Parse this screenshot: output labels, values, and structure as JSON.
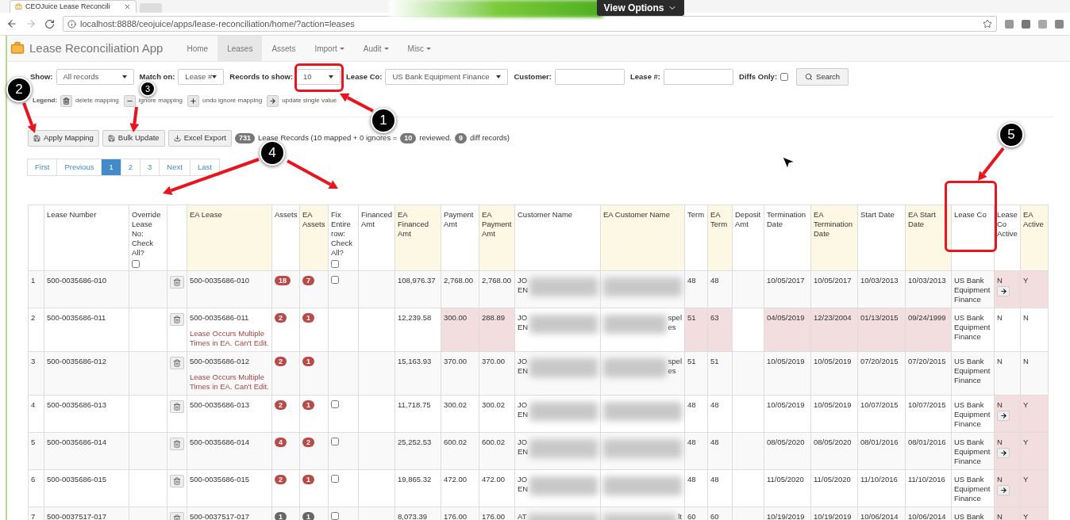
{
  "browser": {
    "tab_title": "CEOJuice Lease Reconcili",
    "view_options": "View Options",
    "url": "localhost:8888/ceojuice/apps/lease-reconciliation/home/?action=leases"
  },
  "app": {
    "title": "Lease Reconciliation App",
    "nav": [
      {
        "label": "Home",
        "selected": false,
        "dropdown": false
      },
      {
        "label": "Leases",
        "selected": true,
        "dropdown": false
      },
      {
        "label": "Assets",
        "selected": false,
        "dropdown": false
      },
      {
        "label": "Import",
        "selected": false,
        "dropdown": true
      },
      {
        "label": "Audit",
        "selected": false,
        "dropdown": true
      },
      {
        "label": "Misc",
        "selected": false,
        "dropdown": true
      }
    ]
  },
  "filters": [
    {
      "kind": "select",
      "label": "Show:",
      "value": "All records"
    },
    {
      "kind": "select",
      "label": "Match on:",
      "value": "Lease #"
    },
    {
      "kind": "select",
      "label": "Records to show:",
      "value": "10"
    },
    {
      "kind": "select",
      "label": "Lease Co:",
      "value": "US Bank Equipment Finance"
    },
    {
      "kind": "input",
      "label": "Customer:"
    },
    {
      "kind": "input",
      "label": "Lease #:"
    },
    {
      "kind": "checkbox",
      "label": "Diffs Only:",
      "checked": false
    }
  ],
  "search_button": "Search",
  "legend": {
    "label": "Legend:",
    "items": [
      {
        "text": "delete mapping"
      },
      {
        "text": "ignore mapping"
      },
      {
        "text": "undo ignore mapping"
      },
      {
        "text": "update single value"
      }
    ]
  },
  "actions": [
    {
      "label": "Apply Mapping"
    },
    {
      "label": "Bulk Update"
    },
    {
      "label": "Excel Export"
    }
  ],
  "summary": [
    {
      "kind": "badge",
      "text": "731"
    },
    {
      "kind": "text",
      "text": "Lease Records (10 mapped + 0 ignores ="
    },
    {
      "kind": "badge",
      "text": "10"
    },
    {
      "kind": "text",
      "text": "reviewed."
    },
    {
      "kind": "badge",
      "text": "9"
    },
    {
      "kind": "text",
      "text": "diff records)"
    }
  ],
  "pagination": [
    {
      "label": "First",
      "selected": false
    },
    {
      "label": "Previous",
      "selected": false
    },
    {
      "label": "1",
      "selected": true
    },
    {
      "label": "2",
      "selected": false
    },
    {
      "label": "3",
      "selected": false
    },
    {
      "label": "Next",
      "selected": false
    },
    {
      "label": "Last",
      "selected": false
    }
  ],
  "table": {
    "columns": [
      {
        "ea": false
      },
      {
        "label": "Lease Number",
        "ea": false
      },
      {
        "label": "Override Lease No: Check All?",
        "ea": false,
        "check_all": false
      },
      {
        "ea": false
      },
      {
        "label": "EA Lease",
        "ea": true
      },
      {
        "label": "Assets",
        "ea": false
      },
      {
        "label": "EA Assets",
        "ea": true
      },
      {
        "label": "Fix Entire row: Check All?",
        "ea": false,
        "check_all": false
      },
      {
        "label": "Financed Amt",
        "ea": false
      },
      {
        "label": "EA Financed Amt",
        "ea": true
      },
      {
        "label": "Payment Amt",
        "ea": false
      },
      {
        "label": "EA Payment Amt",
        "ea": true
      },
      {
        "label": "Customer Name",
        "ea": false
      },
      {
        "label": "EA Customer Name",
        "ea": true
      },
      {
        "label": "Term",
        "ea": false
      },
      {
        "label": "EA Term",
        "ea": true
      },
      {
        "label": "Deposit Amt",
        "ea": false
      },
      {
        "label": "Termination Date",
        "ea": false
      },
      {
        "label": "EA Termination Date",
        "ea": true
      },
      {
        "label": "Start Date",
        "ea": false
      },
      {
        "label": "EA Start Date",
        "ea": true
      },
      {
        "label": "Lease Co",
        "ea": false
      },
      {
        "label": "Lease Co Active",
        "ea": false
      },
      {
        "label": "EA Active",
        "ea": true
      }
    ],
    "rows": [
      {
        "cells": [
          {
            "kind": "text",
            "text": "1",
            "diff": false
          },
          {
            "kind": "text",
            "text": "500-0035686-010",
            "diff": false
          },
          {
            "kind": "empty",
            "diff": false
          },
          {
            "kind": "trash",
            "diff": false
          },
          {
            "kind": "lease",
            "text": "500-0035686-010",
            "diff": false
          },
          {
            "kind": "badge",
            "text": "18",
            "color": "#b94a48",
            "diff": false
          },
          {
            "kind": "badge",
            "text": "7",
            "color": "#b94a48",
            "diff": false
          },
          {
            "kind": "checkbox",
            "checked": false,
            "diff": false
          },
          {
            "kind": "empty",
            "diff": false
          },
          {
            "kind": "text",
            "text": "108,976.37",
            "diff": false
          },
          {
            "kind": "text",
            "text": "2,768.00",
            "diff": false
          },
          {
            "kind": "text",
            "text": "2,768.00",
            "diff": false
          },
          {
            "kind": "blurred",
            "lines": [
              "JO",
              "EN"
            ],
            "diff": false
          },
          {
            "kind": "blurred",
            "diff": false
          },
          {
            "kind": "text",
            "text": "48",
            "diff": false
          },
          {
            "kind": "text",
            "text": "48",
            "diff": false
          },
          {
            "kind": "empty",
            "diff": false
          },
          {
            "kind": "text",
            "text": "10/05/2017",
            "diff": false
          },
          {
            "kind": "text",
            "text": "10/05/2017",
            "diff": false
          },
          {
            "kind": "text",
            "text": "10/03/2013",
            "diff": false
          },
          {
            "kind": "text",
            "text": "10/03/2013",
            "diff": false
          },
          {
            "kind": "text",
            "text": "US Bank Equipment Finance",
            "diff": false
          },
          {
            "kind": "active",
            "text": "N",
            "update_button": true,
            "diff": true
          },
          {
            "kind": "text",
            "text": "Y",
            "diff": true
          }
        ]
      },
      {
        "cells": [
          {
            "kind": "text",
            "text": "2",
            "diff": false
          },
          {
            "kind": "text",
            "text": "500-0035686-011",
            "diff": false
          },
          {
            "kind": "empty",
            "diff": false
          },
          {
            "kind": "trash",
            "diff": false
          },
          {
            "kind": "lease",
            "text": "500-0035686-011",
            "warning": "Lease Occurs Multiple Times in EA. Can't Edit.",
            "diff": false
          },
          {
            "kind": "badge",
            "text": "2",
            "color": "#b94a48",
            "diff": false
          },
          {
            "kind": "badge",
            "text": "1",
            "color": "#b94a48",
            "diff": false
          },
          {
            "kind": "empty",
            "diff": false
          },
          {
            "kind": "empty",
            "diff": false
          },
          {
            "kind": "text",
            "text": "12,239.58",
            "diff": false
          },
          {
            "kind": "text",
            "text": "300.00",
            "diff": true
          },
          {
            "kind": "text",
            "text": "288.89",
            "diff": true
          },
          {
            "kind": "blurred",
            "lines": [
              "JO",
              "EN"
            ],
            "diff": false
          },
          {
            "kind": "blurred",
            "lines": [
              "spel",
              "es"
            ],
            "diff": false
          },
          {
            "kind": "text",
            "text": "51",
            "diff": true
          },
          {
            "kind": "text",
            "text": "63",
            "diff": true
          },
          {
            "kind": "empty",
            "diff": false
          },
          {
            "kind": "text",
            "text": "04/05/2019",
            "diff": true
          },
          {
            "kind": "text",
            "text": "12/23/2004",
            "diff": true
          },
          {
            "kind": "text",
            "text": "01/13/2015",
            "diff": true
          },
          {
            "kind": "text",
            "text": "09/24/1999",
            "diff": true
          },
          {
            "kind": "text",
            "text": "US Bank Equipment Finance",
            "diff": false
          },
          {
            "kind": "active",
            "text": "N",
            "update_button": false,
            "diff": false
          },
          {
            "kind": "text",
            "text": "N",
            "diff": false
          }
        ]
      },
      {
        "cells": [
          {
            "kind": "text",
            "text": "3",
            "diff": false
          },
          {
            "kind": "text",
            "text": "500-0035686-012",
            "diff": false
          },
          {
            "kind": "empty",
            "diff": false
          },
          {
            "kind": "trash",
            "diff": false
          },
          {
            "kind": "lease",
            "text": "500-0035686-012",
            "warning": "Lease Occurs Multiple Times in EA. Can't Edit.",
            "diff": false
          },
          {
            "kind": "badge",
            "text": "2",
            "color": "#b94a48",
            "diff": false
          },
          {
            "kind": "badge",
            "text": "1",
            "color": "#b94a48",
            "diff": false
          },
          {
            "kind": "empty",
            "diff": false
          },
          {
            "kind": "empty",
            "diff": false
          },
          {
            "kind": "text",
            "text": "15,163.93",
            "diff": false
          },
          {
            "kind": "text",
            "text": "370.00",
            "diff": false
          },
          {
            "kind": "text",
            "text": "370.00",
            "diff": false
          },
          {
            "kind": "blurred",
            "lines": [
              "JO",
              "EN"
            ],
            "diff": false
          },
          {
            "kind": "blurred",
            "lines": [
              "spel",
              "es"
            ],
            "diff": false
          },
          {
            "kind": "text",
            "text": "51",
            "diff": false
          },
          {
            "kind": "text",
            "text": "51",
            "diff": false
          },
          {
            "kind": "empty",
            "diff": false
          },
          {
            "kind": "text",
            "text": "10/05/2019",
            "diff": false
          },
          {
            "kind": "text",
            "text": "10/05/2019",
            "diff": false
          },
          {
            "kind": "text",
            "text": "07/20/2015",
            "diff": false
          },
          {
            "kind": "text",
            "text": "07/20/2015",
            "diff": false
          },
          {
            "kind": "text",
            "text": "US Bank Equipment Finance",
            "diff": false
          },
          {
            "kind": "active",
            "text": "N",
            "update_button": false,
            "diff": false
          },
          {
            "kind": "text",
            "text": "N",
            "diff": false
          }
        ]
      },
      {
        "cells": [
          {
            "kind": "text",
            "text": "4",
            "diff": false
          },
          {
            "kind": "text",
            "text": "500-0035686-013",
            "diff": false
          },
          {
            "kind": "empty",
            "diff": false
          },
          {
            "kind": "trash",
            "diff": false
          },
          {
            "kind": "lease",
            "text": "500-0035686-013",
            "diff": false
          },
          {
            "kind": "badge",
            "text": "2",
            "color": "#b94a48",
            "diff": false
          },
          {
            "kind": "badge",
            "text": "1",
            "color": "#b94a48",
            "diff": false
          },
          {
            "kind": "checkbox",
            "checked": false,
            "diff": false
          },
          {
            "kind": "empty",
            "diff": false
          },
          {
            "kind": "text",
            "text": "11,718.75",
            "diff": false
          },
          {
            "kind": "text",
            "text": "300.02",
            "diff": false
          },
          {
            "kind": "text",
            "text": "300.02",
            "diff": false
          },
          {
            "kind": "blurred",
            "lines": [
              "JO",
              "EN"
            ],
            "diff": false
          },
          {
            "kind": "blurred",
            "diff": false
          },
          {
            "kind": "text",
            "text": "48",
            "diff": false
          },
          {
            "kind": "text",
            "text": "48",
            "diff": false
          },
          {
            "kind": "empty",
            "diff": false
          },
          {
            "kind": "text",
            "text": "10/05/2019",
            "diff": false
          },
          {
            "kind": "text",
            "text": "10/05/2019",
            "diff": false
          },
          {
            "kind": "text",
            "text": "10/07/2015",
            "diff": false
          },
          {
            "kind": "text",
            "text": "10/07/2015",
            "diff": false
          },
          {
            "kind": "text",
            "text": "US Bank Equipment Finance",
            "diff": false
          },
          {
            "kind": "active",
            "text": "N",
            "update_button": true,
            "diff": true
          },
          {
            "kind": "text",
            "text": "Y",
            "diff": true
          }
        ]
      },
      {
        "cells": [
          {
            "kind": "text",
            "text": "5",
            "diff": false
          },
          {
            "kind": "text",
            "text": "500-0035686-014",
            "diff": false
          },
          {
            "kind": "empty",
            "diff": false
          },
          {
            "kind": "trash",
            "diff": false
          },
          {
            "kind": "lease",
            "text": "500-0035686-014",
            "diff": false
          },
          {
            "kind": "badge",
            "text": "4",
            "color": "#b94a48",
            "diff": false
          },
          {
            "kind": "badge",
            "text": "2",
            "color": "#b94a48",
            "diff": false
          },
          {
            "kind": "checkbox",
            "checked": false,
            "diff": false
          },
          {
            "kind": "empty",
            "diff": false
          },
          {
            "kind": "text",
            "text": "25,252.53",
            "diff": false
          },
          {
            "kind": "text",
            "text": "600.02",
            "diff": false
          },
          {
            "kind": "text",
            "text": "600.02",
            "diff": false
          },
          {
            "kind": "blurred",
            "lines": [
              "JO",
              "EN"
            ],
            "diff": false
          },
          {
            "kind": "blurred",
            "diff": false
          },
          {
            "kind": "text",
            "text": "48",
            "diff": false
          },
          {
            "kind": "text",
            "text": "48",
            "diff": false
          },
          {
            "kind": "empty",
            "diff": false
          },
          {
            "kind": "text",
            "text": "08/05/2020",
            "diff": false
          },
          {
            "kind": "text",
            "text": "08/05/2020",
            "diff": false
          },
          {
            "kind": "text",
            "text": "08/01/2016",
            "diff": false
          },
          {
            "kind": "text",
            "text": "08/01/2016",
            "diff": false
          },
          {
            "kind": "text",
            "text": "US Bank Equipment Finance",
            "diff": false
          },
          {
            "kind": "active",
            "text": "N",
            "update_button": true,
            "diff": true
          },
          {
            "kind": "text",
            "text": "Y",
            "diff": true
          }
        ]
      },
      {
        "cells": [
          {
            "kind": "text",
            "text": "6",
            "diff": false
          },
          {
            "kind": "text",
            "text": "500-0035686-015",
            "diff": false
          },
          {
            "kind": "empty",
            "diff": false
          },
          {
            "kind": "trash",
            "diff": false
          },
          {
            "kind": "lease",
            "text": "500-0035686-015",
            "diff": false
          },
          {
            "kind": "badge",
            "text": "2",
            "color": "#b94a48",
            "diff": false
          },
          {
            "kind": "badge",
            "text": "1",
            "color": "#b94a48",
            "diff": false
          },
          {
            "kind": "checkbox",
            "checked": false,
            "diff": false
          },
          {
            "kind": "empty",
            "diff": false
          },
          {
            "kind": "text",
            "text": "19,865.32",
            "diff": false
          },
          {
            "kind": "text",
            "text": "472.00",
            "diff": false
          },
          {
            "kind": "text",
            "text": "472.00",
            "diff": false
          },
          {
            "kind": "blurred",
            "lines": [
              "JO",
              "EN"
            ],
            "diff": false
          },
          {
            "kind": "blurred",
            "diff": false
          },
          {
            "kind": "text",
            "text": "48",
            "diff": false
          },
          {
            "kind": "text",
            "text": "48",
            "diff": false
          },
          {
            "kind": "empty",
            "diff": false
          },
          {
            "kind": "text",
            "text": "11/05/2020",
            "diff": false
          },
          {
            "kind": "text",
            "text": "11/05/2020",
            "diff": false
          },
          {
            "kind": "text",
            "text": "11/10/2016",
            "diff": false
          },
          {
            "kind": "text",
            "text": "11/10/2016",
            "diff": false
          },
          {
            "kind": "text",
            "text": "US Bank Equipment Finance",
            "diff": false
          },
          {
            "kind": "active",
            "text": "N",
            "update_button": true,
            "diff": true
          },
          {
            "kind": "text",
            "text": "Y",
            "diff": true
          }
        ]
      },
      {
        "cells": [
          {
            "kind": "text",
            "text": "7",
            "diff": false
          },
          {
            "kind": "text",
            "text": "500-0037517-017",
            "diff": false
          },
          {
            "kind": "empty",
            "diff": false
          },
          {
            "kind": "trash",
            "diff": false
          },
          {
            "kind": "lease",
            "text": "500-0037517-017",
            "diff": false
          },
          {
            "kind": "badge",
            "text": "1",
            "color": "#666666",
            "diff": false
          },
          {
            "kind": "badge",
            "text": "1",
            "color": "#666666",
            "diff": false
          },
          {
            "kind": "checkbox",
            "checked": false,
            "diff": false
          },
          {
            "kind": "empty",
            "diff": false
          },
          {
            "kind": "text",
            "text": "8,073.39",
            "diff": false
          },
          {
            "kind": "text",
            "text": "176.00",
            "diff": false
          },
          {
            "kind": "text",
            "text": "176.00",
            "diff": false
          },
          {
            "kind": "blurred",
            "lines": [
              "AT"
            ],
            "diff": false
          },
          {
            "kind": "blurred",
            "lines": [
              "lt"
            ],
            "diff": false
          },
          {
            "kind": "text",
            "text": "60",
            "diff": false
          },
          {
            "kind": "text",
            "text": "60",
            "diff": false
          },
          {
            "kind": "empty",
            "diff": false
          },
          {
            "kind": "text",
            "text": "10/19/2019",
            "diff": false
          },
          {
            "kind": "text",
            "text": "10/19/2019",
            "diff": false
          },
          {
            "kind": "text",
            "text": "10/06/2014",
            "diff": false
          },
          {
            "kind": "text",
            "text": "10/06/2014",
            "diff": false
          },
          {
            "kind": "text",
            "text": "US Bank",
            "diff": false
          },
          {
            "kind": "active",
            "text": "N",
            "diff": true
          },
          {
            "kind": "text",
            "text": "Y",
            "diff": true
          }
        ]
      }
    ]
  },
  "callouts": [
    {
      "number": "1"
    },
    {
      "number": "2"
    },
    {
      "number": "3"
    },
    {
      "number": "4"
    },
    {
      "number": "5"
    }
  ]
}
